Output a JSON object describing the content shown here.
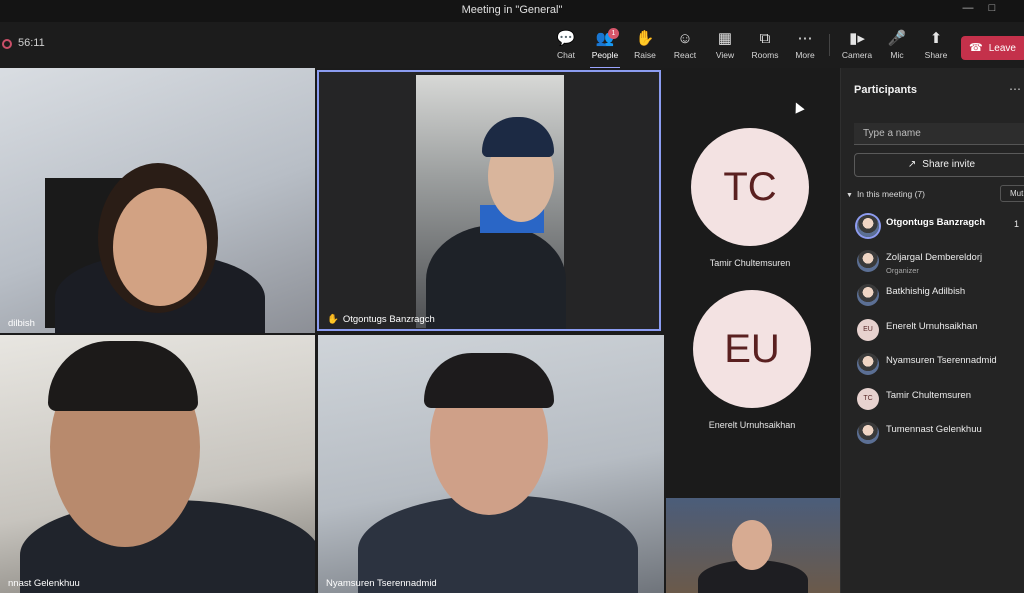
{
  "window": {
    "title": "Meeting in \"General\""
  },
  "toolbar": {
    "timer": "56:11",
    "tools": [
      {
        "label": "Chat",
        "icon": "chat-icon"
      },
      {
        "label": "People",
        "icon": "people-icon",
        "badge": "1"
      },
      {
        "label": "Raise",
        "icon": "raise-hand-icon"
      },
      {
        "label": "React",
        "icon": "react-icon"
      },
      {
        "label": "View",
        "icon": "view-icon"
      },
      {
        "label": "Rooms",
        "icon": "rooms-icon"
      },
      {
        "label": "More",
        "icon": "more-icon"
      },
      {
        "label": "Camera",
        "icon": "camera-icon"
      },
      {
        "label": "Mic",
        "icon": "mic-icon"
      },
      {
        "label": "Share",
        "icon": "share-icon"
      }
    ],
    "leave_label": "Leave"
  },
  "stage": {
    "tiles": [
      {
        "name": "dilbish"
      },
      {
        "name": "Otgontugs Banzragch"
      },
      {
        "name": "nnast Gelenkhuu"
      },
      {
        "name": "Nyamsuren Tserennadmid"
      },
      {
        "name": ""
      }
    ],
    "avatars": [
      {
        "initials": "TC",
        "name": "Tamir Chultemsuren"
      },
      {
        "initials": "EU",
        "name": "Enerelt Urnuhsaikhan"
      }
    ]
  },
  "panel": {
    "title": "Participants",
    "search_placeholder": "Type a name",
    "share_invite": "Share invite",
    "section_label": "In this meeting (7)",
    "mute_all": "Mut",
    "participants": [
      {
        "name": "Otgontugs Banzragch",
        "role": "",
        "initials": "",
        "hand": "1"
      },
      {
        "name": "Zoljargal Dembereldorj",
        "role": "Organizer",
        "initials": "",
        "hand": ""
      },
      {
        "name": "Batkhishig Adilbish",
        "role": "",
        "initials": "",
        "hand": ""
      },
      {
        "name": "Enerelt Urnuhsaikhan",
        "role": "",
        "initials": "EU",
        "hand": ""
      },
      {
        "name": "Nyamsuren Tserennadmid",
        "role": "",
        "initials": "",
        "hand": ""
      },
      {
        "name": "Tamir Chultemsuren",
        "role": "",
        "initials": "TC",
        "hand": ""
      },
      {
        "name": "Tumennast Gelenkhuu",
        "role": "",
        "initials": "",
        "hand": ""
      }
    ]
  },
  "colors": {
    "accent": "#8b9cf0",
    "leave": "#c4314b",
    "badge": "#d6566b"
  }
}
